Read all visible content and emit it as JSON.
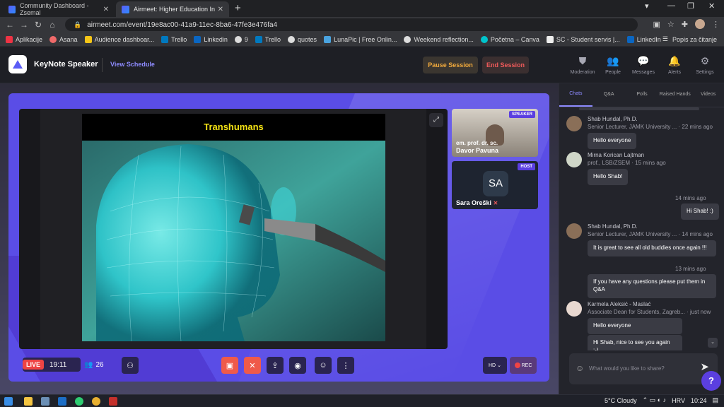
{
  "browser": {
    "tabs": [
      {
        "title": "Community Dashboard - Zsemal",
        "active": false
      },
      {
        "title": "Airmeet: Higher Education In",
        "active": true
      }
    ],
    "url": "airmeet.com/event/19e8ac00-41a9-11ec-8ba6-47fe3e476fa4",
    "bookmarks": [
      "Aplikacije",
      "Asana",
      "Audience dashboar...",
      "Trello",
      "Linkedin",
      "9",
      "Trello",
      "quotes",
      "LunaPic | Free Onlin...",
      "Weekend reflection...",
      "Početna – Canva",
      "SC - Student servis |...",
      "LinkedIn"
    ],
    "reading_list": "Popis za čitanje"
  },
  "header": {
    "event_title": "KeyNote Speaker",
    "view_schedule": "View Schedule",
    "pause_label": "Pause Session",
    "end_label": "End Session",
    "nav": [
      {
        "label": "Moderation",
        "icon": "shield-icon"
      },
      {
        "label": "People",
        "icon": "people-icon"
      },
      {
        "label": "Messages",
        "icon": "messages-icon"
      },
      {
        "label": "Alerts",
        "icon": "bell-icon"
      },
      {
        "label": "Settings",
        "icon": "gear-icon"
      }
    ]
  },
  "stage": {
    "slide_title": "Transhumans",
    "speaker": {
      "badge": "SPEAKER",
      "name_line1": "em. prof. dr. sc.",
      "name_line2": "Davor Pavuna"
    },
    "host": {
      "badge": "HOST",
      "initials": "SA",
      "name": "Sara Oreški"
    },
    "live_tag": "LIVE",
    "timer": "19:11",
    "attendees": "26",
    "quality": "HD",
    "rec_label": "REC"
  },
  "chat": {
    "tabs": [
      "Chats",
      "Q&A",
      "Polls",
      "Raised Hands",
      "Videos"
    ],
    "messages": [
      {
        "name": "Shab Hundal, Ph.D.",
        "sub": "Senior Lecturer, JAMK University ...",
        "time": "22 mins ago",
        "text": "Hello everyone"
      },
      {
        "name": "Mirna Korican Lajtman",
        "sub": "prof., LSB/ZSEM",
        "time": "15 mins ago",
        "text": "Hello Shab!"
      },
      {
        "time": "14 mins ago",
        "text": "Hi Shab! :)"
      },
      {
        "name": "Shab Hundal, Ph.D.",
        "sub": "Senior Lecturer, JAMK University ...",
        "time": "14 mins ago",
        "text": "It is great to see all old buddies once again !!!"
      },
      {
        "time": "13 mins ago",
        "text": "If you have any questions please put them in Q&A"
      },
      {
        "name": "Karmela Aleksić - Maslać",
        "sub": "Associate Dean for Students, Zagreb...",
        "time": "just now",
        "text": "Hello everyone",
        "text2": "Hi Shab, nice to see you again :-)"
      }
    ],
    "input_placeholder": "What would you like to share?"
  },
  "taskbar": {
    "weather": "5°C  Cloudy",
    "lang": "HRV",
    "time": "10:24"
  },
  "colors": {
    "accent": "#5b4de6",
    "live": "#ef4444",
    "link": "#8e8bff"
  }
}
